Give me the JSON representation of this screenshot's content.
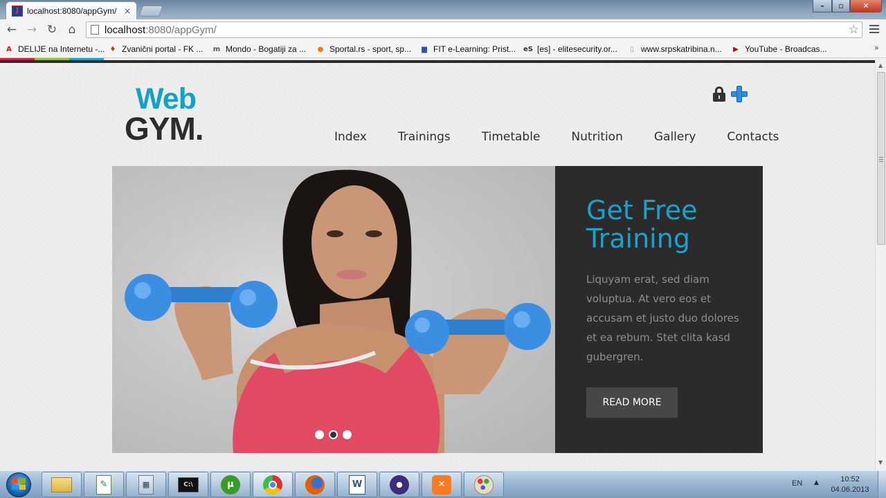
{
  "browser": {
    "tab_title": "localhost:8080/appGym/",
    "tab_close_glyph": "×",
    "url_host": "localhost",
    "url_path": ":8080/appGym/",
    "window_buttons": {
      "minimize": "–",
      "maximize": "▫",
      "close": "✕"
    },
    "bookmarks": [
      {
        "label": "DELIJE na Internetu -...",
        "icon": "red-a-icon",
        "color": "#d4121b"
      },
      {
        "label": "Zvanični portal - FK ...",
        "icon": "crest-icon",
        "color": "#c0392b"
      },
      {
        "label": "Mondo - Bogatiji za ...",
        "icon": "mondo-icon",
        "color": "#555555"
      },
      {
        "label": "Sportal.rs - sport, sp...",
        "icon": "sportal-circle-icon",
        "color": "#f07c00"
      },
      {
        "label": "FIT e-Learning: Prist...",
        "icon": "monitor-icon",
        "color": "#2a56a8"
      },
      {
        "label": "[es] - elitesecurity.or...",
        "icon": "es-icon",
        "color": "#333333"
      },
      {
        "label": "www.srpskatribina.n...",
        "icon": "blank-page-icon",
        "color": "#999999"
      },
      {
        "label": "YouTube - Broadcas...",
        "icon": "youtube-icon",
        "color": "#cc0000"
      }
    ],
    "bookmarks_overflow": "»"
  },
  "site": {
    "accent_color": "#13a1c4",
    "logo": {
      "line1": "Web",
      "line2": "GYM."
    },
    "nav": [
      "Index",
      "Trainings",
      "Timetable",
      "Nutrition",
      "Gallery",
      "Contacts"
    ],
    "colorbar": [
      "#cc1f4e",
      "#9bc31d",
      "#1aa6d4"
    ]
  },
  "slider": {
    "headline": "Get Free Training",
    "body": "Liquyam erat, sed diam voluptua. At vero eos et accusam et justo duo dolores et ea rebum. Stet clita kasd gubergren.",
    "button_label": "READ MORE",
    "dots_count": 3,
    "active_dot": 2
  },
  "taskbar": {
    "apps": [
      {
        "name": "explorer",
        "icon": "folder-icon"
      },
      {
        "name": "notepad++",
        "icon": "notepad-icon"
      },
      {
        "name": "calculator",
        "icon": "calculator-icon"
      },
      {
        "name": "cmd",
        "icon": "terminal-icon"
      },
      {
        "name": "utorrent",
        "icon": "utorrent-icon"
      },
      {
        "name": "chrome",
        "icon": "chrome-icon",
        "active": true
      },
      {
        "name": "firefox",
        "icon": "firefox-icon"
      },
      {
        "name": "word",
        "icon": "word-icon"
      },
      {
        "name": "eclipse",
        "icon": "eclipse-icon"
      },
      {
        "name": "xampp",
        "icon": "xampp-icon"
      },
      {
        "name": "paint",
        "icon": "paint-icon"
      }
    ],
    "language": "EN",
    "time": "10:52",
    "date": "04.06.2013"
  }
}
